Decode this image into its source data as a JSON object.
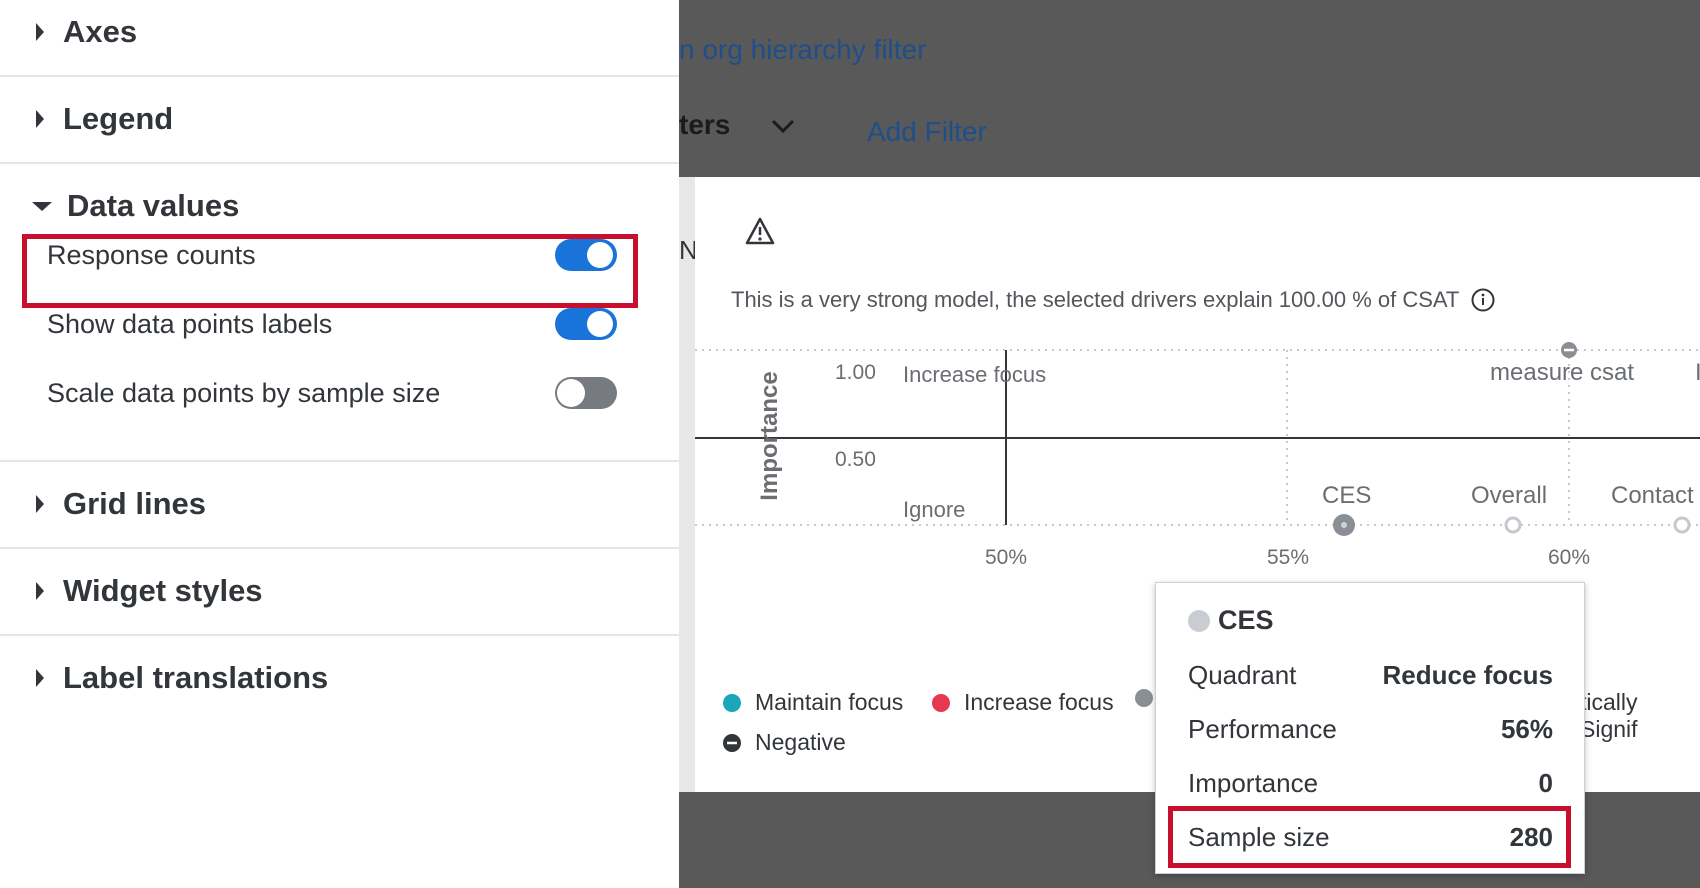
{
  "panel": {
    "sections": {
      "axes": "Axes",
      "legend": "Legend",
      "data_values": "Data values",
      "grid_lines": "Grid lines",
      "widget_styles": "Widget styles",
      "label_translations": "Label translations"
    },
    "toggles": [
      {
        "label": "Response counts",
        "state": "on"
      },
      {
        "label": "Show data points labels",
        "state": "on"
      },
      {
        "label": "Scale data points by sample size",
        "state": "off"
      }
    ]
  },
  "background": {
    "filter_link": "n org hierarchy filter",
    "filters_label": "ters",
    "add_filter": "Add Filter"
  },
  "card": {
    "model_text": "This is a very strong model, the selected drivers explain 100.00 % of CSAT",
    "cut_text": "N",
    "chart": {
      "y_axis_label": "Importance",
      "y_ticks": [
        "1.00",
        "0.50"
      ],
      "x_ticks": [
        "50%",
        "55%",
        "60%"
      ],
      "quadrants": {
        "top_left": "Increase focus",
        "bottom_left": "Ignore"
      },
      "points": [
        {
          "label": "measure csat"
        },
        {
          "label": "CES"
        },
        {
          "label": "Overall"
        },
        {
          "label": "Contact"
        }
      ],
      "cut_right_label": "I"
    },
    "legend": {
      "maintain": "Maintain focus",
      "increase": "Increase focus",
      "stat_sig": "tically Signif",
      "negative": "Negative"
    }
  },
  "tooltip": {
    "title": "CES",
    "rows": [
      {
        "label": "Quadrant",
        "value": "Reduce focus"
      },
      {
        "label": "Performance",
        "value": "56%"
      },
      {
        "label": "Importance",
        "value": "0"
      },
      {
        "label": "Sample size",
        "value": "280"
      }
    ]
  },
  "colors": {
    "accent_toggle": "#1a73d9",
    "highlight": "#c8102e",
    "maintain_dot": "#1aa5b8",
    "increase_dot": "#e8384f",
    "grey_dot": "#8a8f96"
  }
}
